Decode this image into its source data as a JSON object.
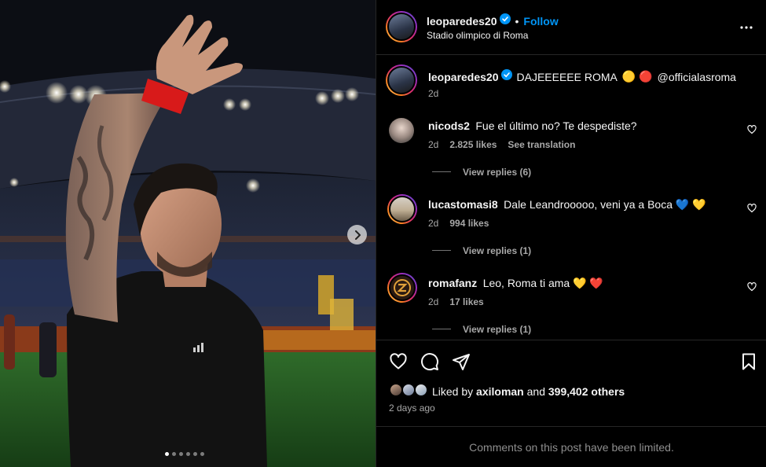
{
  "post": {
    "author": "leoparedes20",
    "location": "Stadio olimpico di Roma",
    "follow_label": "Follow",
    "dot_separator": "•",
    "more_icon": "more-horizontal-icon"
  },
  "caption": {
    "author": "leoparedes20",
    "text": "DAJEEEEEE ROMA",
    "emojis": "🟡 🔴",
    "mention": "@officialasroma",
    "time": "2d"
  },
  "comments": [
    {
      "user": "nicods2",
      "text": "Fue el último no? Te despediste?",
      "time": "2d",
      "likes": "2.825 likes",
      "translate": "See translation",
      "replies": "View replies (6)"
    },
    {
      "user": "lucastomasi8",
      "text": "Dale Leandrooooo, veni ya a Boca 💙 💛",
      "time": "2d",
      "likes": "994 likes",
      "replies": "View replies (1)"
    },
    {
      "user": "romafanz",
      "text": "Leo, Roma ti ama 💛 ❤️",
      "time": "2d",
      "likes": "17 likes",
      "replies": "View replies (1)"
    }
  ],
  "likes": {
    "prefix": "Liked by",
    "user": "axiloman",
    "and": "and",
    "others": "399,402 others",
    "date": "2 days ago"
  },
  "footer": {
    "text": "Comments on this post have been limited."
  },
  "carousel": {
    "total": 6,
    "active": 1
  },
  "colors": {
    "accent": "#0095f6",
    "background": "#000000",
    "divider": "#262626",
    "muted": "#a8a8a8"
  }
}
